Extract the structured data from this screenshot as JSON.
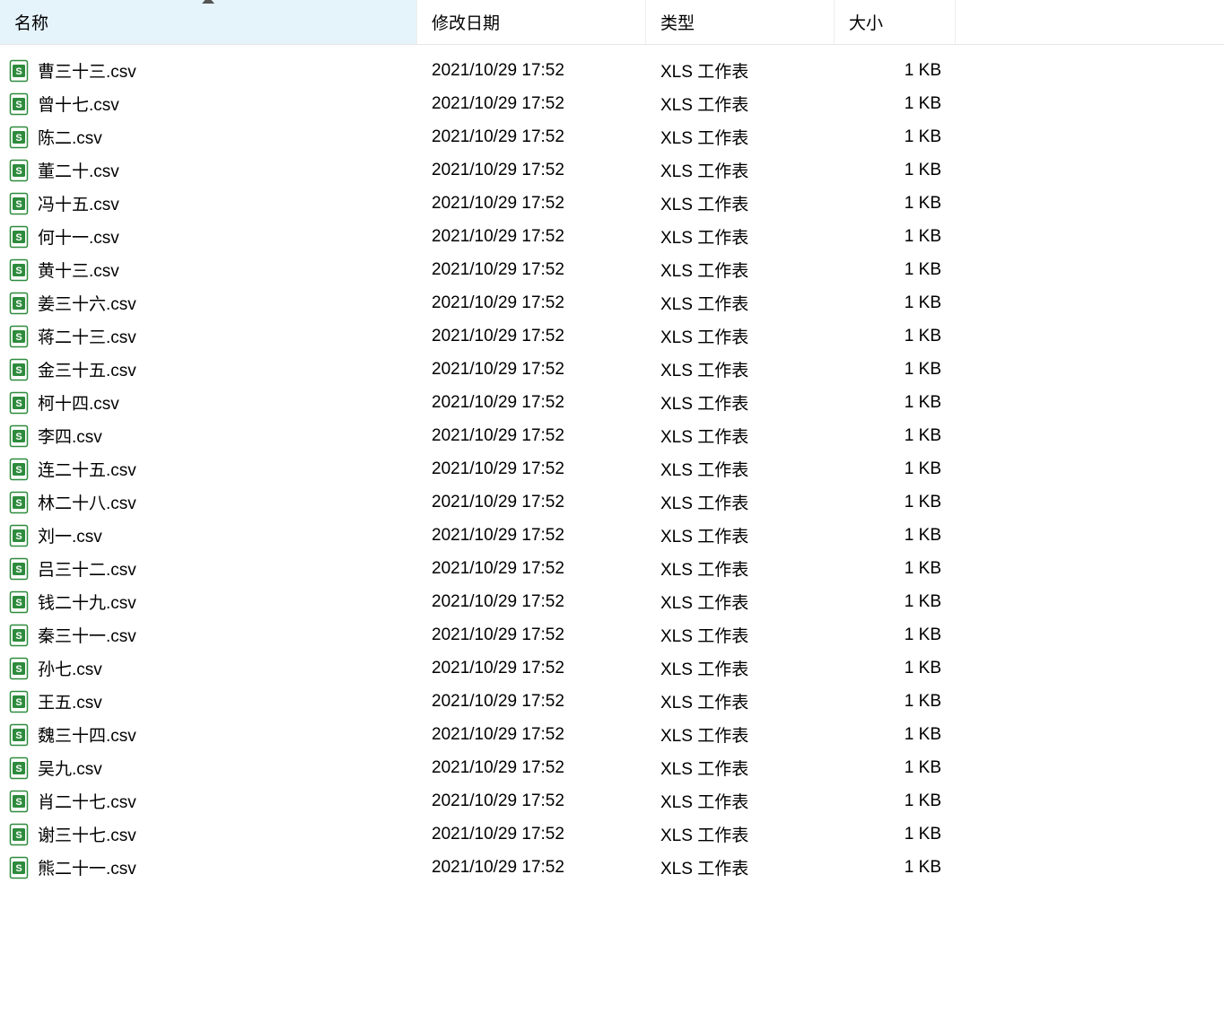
{
  "headers": {
    "name": "名称",
    "date": "修改日期",
    "type": "类型",
    "size": "大小"
  },
  "files": [
    {
      "name": "曹三十三.csv",
      "date": "2021/10/29 17:52",
      "type": "XLS 工作表",
      "size": "1 KB"
    },
    {
      "name": "曾十七.csv",
      "date": "2021/10/29 17:52",
      "type": "XLS 工作表",
      "size": "1 KB"
    },
    {
      "name": "陈二.csv",
      "date": "2021/10/29 17:52",
      "type": "XLS 工作表",
      "size": "1 KB"
    },
    {
      "name": "董二十.csv",
      "date": "2021/10/29 17:52",
      "type": "XLS 工作表",
      "size": "1 KB"
    },
    {
      "name": "冯十五.csv",
      "date": "2021/10/29 17:52",
      "type": "XLS 工作表",
      "size": "1 KB"
    },
    {
      "name": "何十一.csv",
      "date": "2021/10/29 17:52",
      "type": "XLS 工作表",
      "size": "1 KB"
    },
    {
      "name": "黄十三.csv",
      "date": "2021/10/29 17:52",
      "type": "XLS 工作表",
      "size": "1 KB"
    },
    {
      "name": "姜三十六.csv",
      "date": "2021/10/29 17:52",
      "type": "XLS 工作表",
      "size": "1 KB"
    },
    {
      "name": "蒋二十三.csv",
      "date": "2021/10/29 17:52",
      "type": "XLS 工作表",
      "size": "1 KB"
    },
    {
      "name": "金三十五.csv",
      "date": "2021/10/29 17:52",
      "type": "XLS 工作表",
      "size": "1 KB"
    },
    {
      "name": "柯十四.csv",
      "date": "2021/10/29 17:52",
      "type": "XLS 工作表",
      "size": "1 KB"
    },
    {
      "name": "李四.csv",
      "date": "2021/10/29 17:52",
      "type": "XLS 工作表",
      "size": "1 KB"
    },
    {
      "name": "连二十五.csv",
      "date": "2021/10/29 17:52",
      "type": "XLS 工作表",
      "size": "1 KB"
    },
    {
      "name": "林二十八.csv",
      "date": "2021/10/29 17:52",
      "type": "XLS 工作表",
      "size": "1 KB"
    },
    {
      "name": "刘一.csv",
      "date": "2021/10/29 17:52",
      "type": "XLS 工作表",
      "size": "1 KB"
    },
    {
      "name": "吕三十二.csv",
      "date": "2021/10/29 17:52",
      "type": "XLS 工作表",
      "size": "1 KB"
    },
    {
      "name": "钱二十九.csv",
      "date": "2021/10/29 17:52",
      "type": "XLS 工作表",
      "size": "1 KB"
    },
    {
      "name": "秦三十一.csv",
      "date": "2021/10/29 17:52",
      "type": "XLS 工作表",
      "size": "1 KB"
    },
    {
      "name": "孙七.csv",
      "date": "2021/10/29 17:52",
      "type": "XLS 工作表",
      "size": "1 KB"
    },
    {
      "name": "王五.csv",
      "date": "2021/10/29 17:52",
      "type": "XLS 工作表",
      "size": "1 KB"
    },
    {
      "name": "魏三十四.csv",
      "date": "2021/10/29 17:52",
      "type": "XLS 工作表",
      "size": "1 KB"
    },
    {
      "name": "吴九.csv",
      "date": "2021/10/29 17:52",
      "type": "XLS 工作表",
      "size": "1 KB"
    },
    {
      "name": "肖二十七.csv",
      "date": "2021/10/29 17:52",
      "type": "XLS 工作表",
      "size": "1 KB"
    },
    {
      "name": "谢三十七.csv",
      "date": "2021/10/29 17:52",
      "type": "XLS 工作表",
      "size": "1 KB"
    },
    {
      "name": "熊二十一.csv",
      "date": "2021/10/29 17:52",
      "type": "XLS 工作表",
      "size": "1 KB"
    }
  ]
}
